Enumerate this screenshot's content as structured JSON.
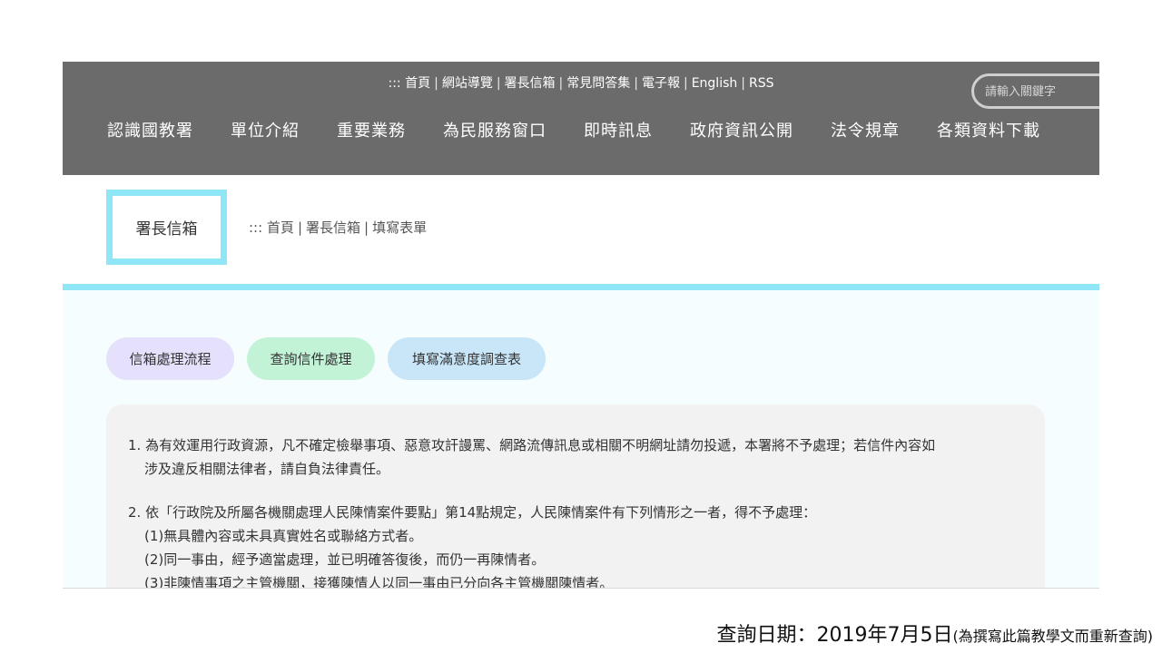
{
  "header": {
    "top_links": [
      {
        "label": "::: 首頁"
      },
      {
        "label": "網站導覽"
      },
      {
        "label": "署長信箱"
      },
      {
        "label": "常見問答集"
      },
      {
        "label": "電子報"
      },
      {
        "label": "English"
      },
      {
        "label": "RSS"
      }
    ],
    "separator": "|",
    "search_placeholder": "請輸入關鍵字",
    "nav": [
      {
        "label": "認識國教署"
      },
      {
        "label": "單位介紹"
      },
      {
        "label": "重要業務"
      },
      {
        "label": "為民服務窗口"
      },
      {
        "label": "即時訊息"
      },
      {
        "label": "政府資訊公開"
      },
      {
        "label": "法令規章"
      },
      {
        "label": "各類資料下載"
      }
    ]
  },
  "page": {
    "title": "署長信箱",
    "breadcrumb": [
      {
        "label": "::: 首頁"
      },
      {
        "label": "署長信箱"
      },
      {
        "label": "填寫表單"
      }
    ]
  },
  "buttons": {
    "flow": "信箱處理流程",
    "query": "查詢信件處理",
    "survey": "填寫滿意度調查表"
  },
  "notice": {
    "line1": "1. 為有效運用行政資源，凡不確定檢舉事項、惡意攻訐謾罵、網路流傳訊息或相關不明網址請勿投遞，本署將不予處理；若信件內容如",
    "line1b": "涉及違反相關法律者，請自負法律責任。",
    "line2": "2. 依「行政院及所屬各機關處理人民陳情案件要點」第14點規定，人民陳情案件有下列情形之一者，得不予處理：",
    "line2a": "(1)無具體內容或未具真實姓名或聯絡方式者。",
    "line2b": "(2)同一事由，經予適當處理，並已明確答復後，而仍一再陳情者。",
    "line2c": "(3)非陳情事項之主管機關，接獲陳情人以同一事由已分向各主管機關陳情者。"
  },
  "caption": {
    "main": "查詢日期：2019年7月5日",
    "note": "(為撰寫此篇教學文而重新查詢)"
  },
  "colors": {
    "header_bg": "#6b6b6b",
    "accent_cyan": "#8ee6f7",
    "pill_flow": "#e5e0fb",
    "pill_query": "#c2f3d7",
    "pill_survey": "#c8e6f8"
  }
}
